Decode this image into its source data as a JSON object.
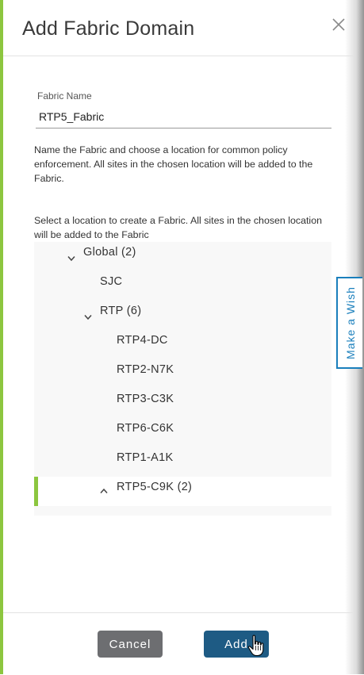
{
  "dialog": {
    "title": "Add Fabric Domain"
  },
  "form": {
    "name_label": "Fabric Name",
    "name_value": "RTP5_Fabric",
    "description": "Name the Fabric and choose a location for common policy enforcement. All sites in the chosen location will be added to the Fabric.",
    "location_hint": "Select a location to create a Fabric. All sites in the chosen location will be added to the Fabric"
  },
  "tree": {
    "global": "Global (2)",
    "sjc": "SJC",
    "rtp": "RTP (6)",
    "rtp4": "RTP4-DC",
    "rtp2": "RTP2-N7K",
    "rtp3": "RTP3-C3K",
    "rtp6": "RTP6-C6K",
    "rtp1": "RTP1-A1K",
    "rtp5": "RTP5-C9K (2)"
  },
  "wish_tab": {
    "label": "Make a Wish"
  },
  "footer": {
    "cancel_label": "Cancel",
    "add_label": "Add"
  },
  "colors": {
    "accent_green": "#8cc63f",
    "primary_blue": "#1e5b84",
    "link_blue": "#1a7fbc",
    "cancel_gray": "#6d6e71"
  }
}
